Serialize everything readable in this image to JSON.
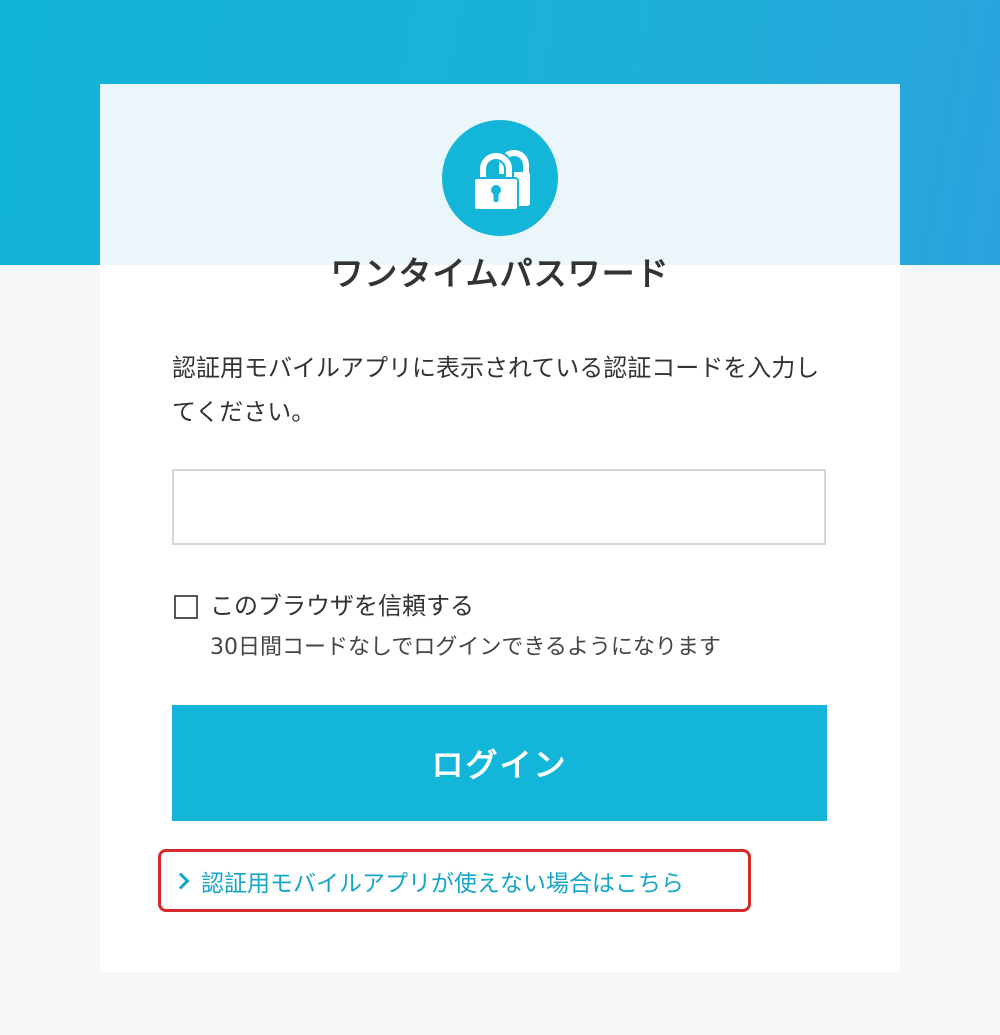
{
  "header": {
    "title": "ワンタイムパスワード",
    "lock_icon": "padlock-icon"
  },
  "form": {
    "description": "認証用モバイルアプリに表示されている認証コードを入力してください。",
    "code_value": "",
    "code_placeholder": "",
    "trust_label": "このブラウザを信頼する",
    "trust_note": "30日間コードなしでログインできるようになります",
    "trust_checked": false,
    "login_label": "ログイン"
  },
  "help": {
    "link_label": "認証用モバイルアプリが使えない場合はこちら",
    "chevron_icon": "chevron-right-icon",
    "highlight_color": "#d62b2b"
  },
  "colors": {
    "accent": "#13b6d8",
    "link": "#13a6c8"
  }
}
